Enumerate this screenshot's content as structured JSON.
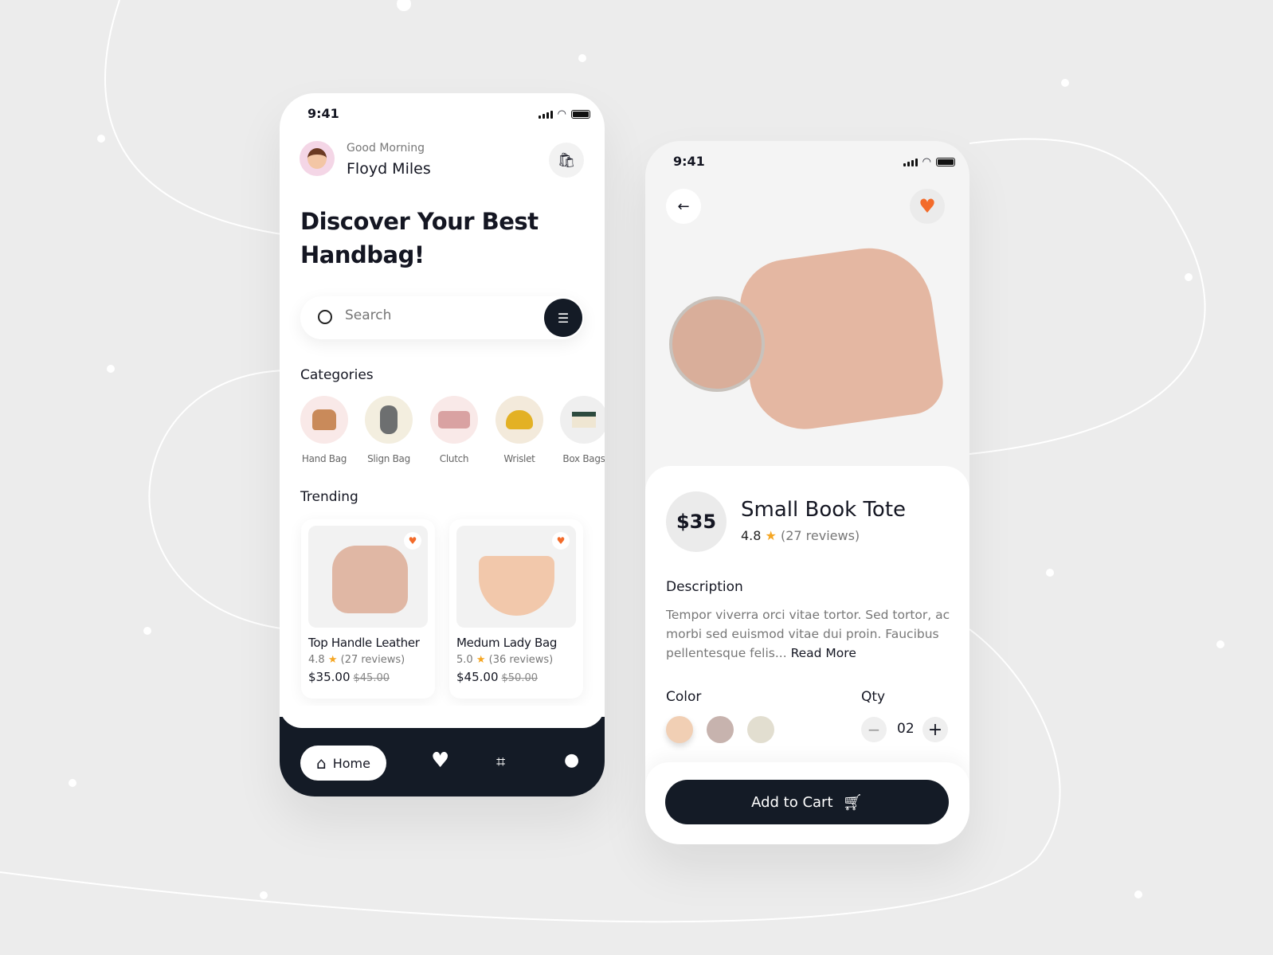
{
  "colors": {
    "accent": "#f36b2a",
    "dark": "#141b26",
    "star": "#f5a623",
    "bg": "#ececec"
  },
  "home": {
    "status_time": "9:41",
    "greeting": "Good Morning",
    "user_name": "Floyd Miles",
    "headline_1": "Discover Your Best",
    "headline_2": "Handbag!",
    "search": {
      "placeholder": "Search",
      "icon": "search-icon",
      "filter_icon": "filter-icon"
    },
    "categories_title": "Categories",
    "categories": [
      {
        "label": "Hand Bag",
        "bg": "#f9e9e8"
      },
      {
        "label": "Slign Bag",
        "bg": "#f3eedf"
      },
      {
        "label": "Clutch",
        "bg": "#f9e9e8"
      },
      {
        "label": "Wrislet",
        "bg": "#f3eadb"
      },
      {
        "label": "Box Bags",
        "bg": "#efefef"
      }
    ],
    "trending_title": "Trending",
    "products": [
      {
        "name": "Top Handle Leather",
        "rating": "4.8",
        "reviews": "(27 reviews)",
        "price": "$35.00",
        "old_price": "$45.00"
      },
      {
        "name": "Medum Lady Bag",
        "rating": "5.0",
        "reviews": "(36 reviews)",
        "price": "$45.00",
        "old_price": "$50.00"
      }
    ],
    "nav": {
      "home_label": "Home",
      "items": [
        "home-icon",
        "heart-icon",
        "scan-icon",
        "profile-icon"
      ]
    }
  },
  "detail": {
    "status_time": "9:41",
    "price_badge": "$35",
    "title": "Small Book Tote",
    "rating": "4.8",
    "reviews": "(27 reviews)",
    "description_title": "Description",
    "description": "Tempor viverra orci vitae tortor. Sed tortor, ac morbi sed euismod vitae dui proin. Faucibus pellentesque felis... ",
    "read_more": "Read More",
    "color_title": "Color",
    "colors": [
      "#f1cfb4",
      "#c7b3ae",
      "#e2ded0"
    ],
    "qty_title": "Qty",
    "qty": "02",
    "add_to_cart": "Add to Cart"
  }
}
